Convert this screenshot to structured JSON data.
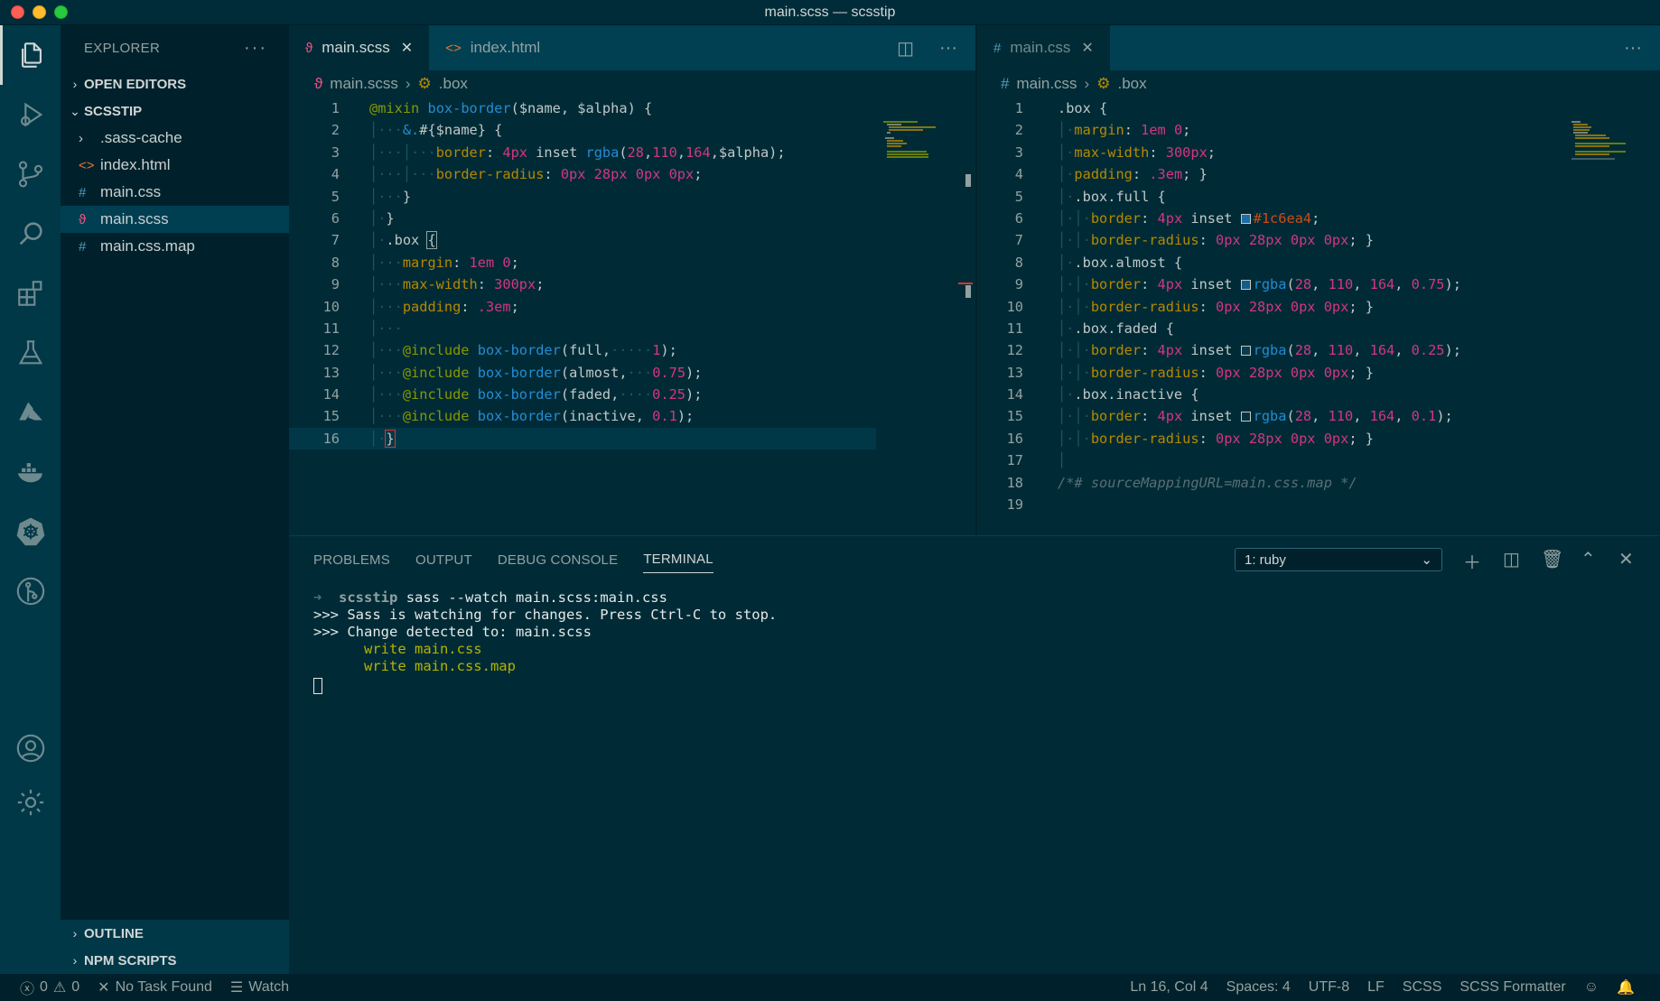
{
  "window": {
    "title": "main.scss — scsstip"
  },
  "activity_bar": {
    "items": [
      "files-icon",
      "debug-icon",
      "source-control-icon",
      "search-icon",
      "extensions-icon",
      "test-icon",
      "azure-icon",
      "docker-icon",
      "kubernetes-icon",
      "gitlens-icon"
    ],
    "bottom": [
      "account-icon",
      "settings-icon"
    ]
  },
  "sidebar": {
    "header": "EXPLORER",
    "sections": {
      "open_editors": "OPEN EDITORS",
      "project": "SCSSTIP",
      "outline": "OUTLINE",
      "npm": "NPM SCRIPTS"
    },
    "files": [
      {
        "name": ".sass-cache",
        "icon": ">",
        "kind": "folder"
      },
      {
        "name": "index.html",
        "icon": "<>",
        "kind": "html"
      },
      {
        "name": "main.css",
        "icon": "#",
        "kind": "css"
      },
      {
        "name": "main.scss",
        "icon": "sass",
        "kind": "scss",
        "selected": true
      },
      {
        "name": "main.css.map",
        "icon": "#",
        "kind": "map"
      }
    ]
  },
  "editor_left": {
    "tabs": [
      {
        "label": "main.scss",
        "active": true
      },
      {
        "label": "index.html",
        "active": false
      }
    ],
    "breadcrumb": {
      "file": "main.scss",
      "symbol": ".box"
    },
    "line_numbers": [
      "1",
      "2",
      "3",
      "4",
      "5",
      "6",
      "7",
      "8",
      "9",
      "10",
      "11",
      "12",
      "13",
      "14",
      "15",
      "16"
    ]
  },
  "editor_right": {
    "tabs": [
      {
        "label": "main.css",
        "active": true
      }
    ],
    "breadcrumb": {
      "file": "main.css",
      "symbol": ".box"
    },
    "line_numbers": [
      "1",
      "2",
      "3",
      "4",
      "5",
      "6",
      "7",
      "8",
      "9",
      "10",
      "11",
      "12",
      "13",
      "14",
      "15",
      "16",
      "17",
      "18",
      "19"
    ]
  },
  "panel": {
    "tabs": [
      "PROBLEMS",
      "OUTPUT",
      "DEBUG CONSOLE",
      "TERMINAL"
    ],
    "active_tab": "TERMINAL",
    "terminal_select": "1: ruby",
    "terminal_lines": {
      "prompt_arrow": "➜",
      "prompt_dir": "scsstip",
      "command": "sass --watch main.scss:main.css",
      "l2": ">>> Sass is watching for changes. Press Ctrl-C to stop.",
      "l3": ">>> Change detected to: main.scss",
      "l4": "      write main.css",
      "l5": "      write main.css.map"
    }
  },
  "statusbar": {
    "errors": "0",
    "warnings": "0",
    "task": "No Task Found",
    "watch": "Watch",
    "position": "Ln 16, Col 4",
    "spaces": "Spaces: 4",
    "encoding": "UTF-8",
    "eol": "LF",
    "language": "SCSS",
    "formatter": "SCSS Formatter"
  },
  "colors": {
    "background": "#002b36",
    "sidebar": "#00212b",
    "tabbar": "#004052",
    "accent_pink": "#d33682",
    "keyword_green": "#859900",
    "function_blue": "#268bd2"
  }
}
